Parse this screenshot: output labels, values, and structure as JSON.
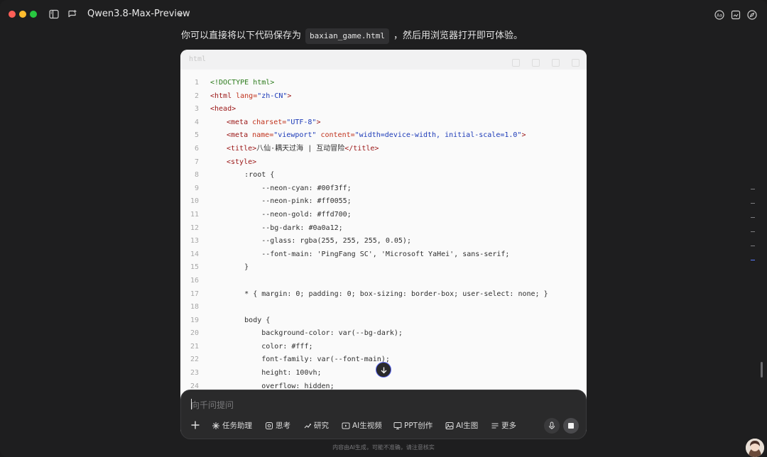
{
  "window": {
    "title": "Qwen3.8-Max-Preview"
  },
  "intro": {
    "pre": "你可以直接将以下代码保存为",
    "filename": "baxian_game.html",
    "post": "，然后用浏览器打开即可体验。"
  },
  "code": {
    "language": "html",
    "lines": [
      {
        "n": "1"
      },
      {
        "n": "2"
      },
      {
        "n": "3"
      },
      {
        "n": "4"
      },
      {
        "n": "5"
      },
      {
        "n": "6"
      },
      {
        "n": "7"
      },
      {
        "n": "8"
      },
      {
        "n": "9"
      },
      {
        "n": "10"
      },
      {
        "n": "11"
      },
      {
        "n": "12"
      },
      {
        "n": "13"
      },
      {
        "n": "14"
      },
      {
        "n": "15"
      },
      {
        "n": "16"
      },
      {
        "n": "17"
      },
      {
        "n": "18"
      },
      {
        "n": "19"
      },
      {
        "n": "20"
      },
      {
        "n": "21"
      },
      {
        "n": "22"
      },
      {
        "n": "23"
      },
      {
        "n": "24"
      }
    ],
    "text": {
      "l1": "<!DOCTYPE html>",
      "l2a": "<html ",
      "l2b": "lang=",
      "l2c": "\"zh-CN\"",
      "l2d": ">",
      "l3": "<head>",
      "l4a": "<meta ",
      "l4b": "charset=",
      "l4c": "\"UTF-8\"",
      "l4d": ">",
      "l5a": "<meta ",
      "l5b": "name=",
      "l5c": "\"viewport\"",
      "l5d": " content=",
      "l5e": "\"width=device-width, initial-scale=1.0\"",
      "l5f": ">",
      "l6a": "<title>",
      "l6b": "八仙·耦天过海 | 互动冒险",
      "l6c": "</title>",
      "l7": "<style>",
      "l8": "        :root {",
      "l9": "            --neon-cyan: #00f3ff;",
      "l10": "            --neon-pink: #ff0055;",
      "l11": "            --neon-gold: #ffd700;",
      "l12": "            --bg-dark: #0a0a12;",
      "l13": "            --glass: rgba(255, 255, 255, 0.05);",
      "l14": "            --font-main: 'PingFang SC', 'Microsoft YaHei', sans-serif;",
      "l15": "        }",
      "l16": "",
      "l17": "        * { margin: 0; padding: 0; box-sizing: border-box; user-select: none; }",
      "l18": "",
      "l19": "        body {",
      "l20": "            background-color: var(--bg-dark);",
      "l21": "            color: #fff;",
      "l22": "            font-family: var(--font-main);",
      "l23": "            height: 100vh;",
      "l24": "            overflow: hidden;"
    }
  },
  "composer": {
    "placeholder": "向千问提问",
    "tools": {
      "task": "任务助理",
      "think": "思考",
      "research": "研究",
      "video": "AI生视频",
      "ppt": "PPT创作",
      "image": "AI生图",
      "more": "更多"
    }
  },
  "footnote": "内容由AI生成，可能不准确，请注意核实",
  "colors": {
    "accent": "#5865f2",
    "close": "#fe5f57",
    "minimize": "#febc2e",
    "maximize": "#28c840"
  }
}
